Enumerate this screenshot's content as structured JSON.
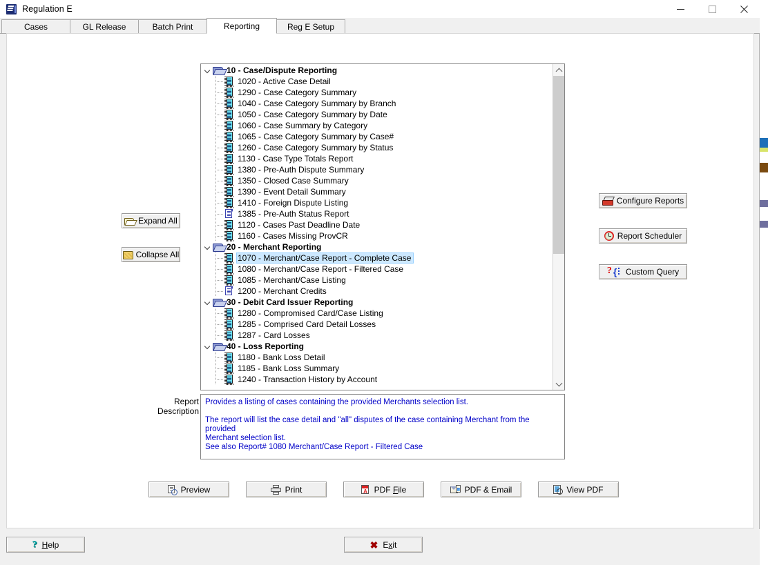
{
  "window": {
    "title": "Regulation E",
    "app_icon": "regulation-e-app-icon",
    "controls": {
      "minimize": "minimize-icon",
      "maximize": "maximize-icon",
      "close": "close-icon"
    }
  },
  "tabs": [
    {
      "label": "Cases",
      "active": false
    },
    {
      "label": "GL Release",
      "active": false
    },
    {
      "label": "Batch Print",
      "active": false
    },
    {
      "label": "Reporting",
      "active": true
    },
    {
      "label": "Reg E Setup",
      "active": false
    }
  ],
  "tree": {
    "selected": "1070 - Merchant/Case Report - Complete Case",
    "nodes": [
      {
        "type": "group",
        "label": "10 - Case/Dispute Reporting"
      },
      {
        "type": "report",
        "label": "1020 - Active Case Detail"
      },
      {
        "type": "report",
        "label": "1290 - Case Category Summary"
      },
      {
        "type": "report",
        "label": "1040 - Case Category Summary by Branch"
      },
      {
        "type": "report",
        "label": "1050 - Case Category Summary by Date"
      },
      {
        "type": "report",
        "label": "1060 - Case Summary by Category"
      },
      {
        "type": "report",
        "label": "1065 - Case Category Summary by Case#"
      },
      {
        "type": "report",
        "label": "1260 - Case Category Summary by Status"
      },
      {
        "type": "report",
        "label": "1130 - Case Type Totals Report"
      },
      {
        "type": "report",
        "label": "1380 - Pre-Auth Dispute Summary"
      },
      {
        "type": "report",
        "label": "1350 - Closed Case Summary"
      },
      {
        "type": "report",
        "label": "1390 - Event Detail Summary"
      },
      {
        "type": "report",
        "label": "1410 - Foreign Dispute Listing"
      },
      {
        "type": "page",
        "label": "1385 - Pre-Auth Status Report"
      },
      {
        "type": "report",
        "label": "1120 - Cases Past Deadline Date"
      },
      {
        "type": "report",
        "label": "1160 - Cases Missing ProvCR"
      },
      {
        "type": "group",
        "label": "20 - Merchant Reporting"
      },
      {
        "type": "report",
        "label": "1070 - Merchant/Case Report - Complete Case",
        "selected": true
      },
      {
        "type": "report",
        "label": "1080 - Merchant/Case Report - Filtered Case"
      },
      {
        "type": "report",
        "label": "1085 - Merchant/Case Listing"
      },
      {
        "type": "page",
        "label": "1200 - Merchant Credits"
      },
      {
        "type": "group",
        "label": "30 - Debit Card Issuer Reporting"
      },
      {
        "type": "report",
        "label": "1280 - Compromised Card/Case Listing"
      },
      {
        "type": "report",
        "label": "1285 - Comprised Card Detail Losses"
      },
      {
        "type": "report",
        "label": "1287 - Card Losses"
      },
      {
        "type": "group",
        "label": "40 - Loss Reporting"
      },
      {
        "type": "report",
        "label": "1180 - Bank Loss Detail"
      },
      {
        "type": "report",
        "label": "1185 - Bank Loss Summary"
      },
      {
        "type": "report",
        "label": "1240 - Transaction History by Account"
      }
    ]
  },
  "tree_buttons": {
    "expand_all": "Expand All",
    "collapse_all": "Collapse All"
  },
  "side_buttons": {
    "configure_reports": "Configure Reports",
    "report_scheduler": "Report Scheduler",
    "custom_query": "Custom Query"
  },
  "description": {
    "label_line1": "Report",
    "label_line2": "Description",
    "line1": "Provides a listing of cases containing the provided Merchants selection list.",
    "line2": "The report will list the case detail and \"all\" disputes of the case containing Merchant from the provided",
    "line3": "Merchant selection list.",
    "line4": "See also Report# 1080 Merchant/Case Report - Filtered Case",
    "text_color": "#0000c8"
  },
  "action_buttons": [
    {
      "label": "Preview",
      "icon": "preview-icon"
    },
    {
      "label": "Print",
      "icon": "printer-icon"
    },
    {
      "label": "PDF File",
      "icon": "pdf-file-icon",
      "accel": "F"
    },
    {
      "label": "PDF & Email",
      "icon": "pdf-email-icon"
    },
    {
      "label": "View PDF",
      "icon": "view-pdf-icon"
    }
  ],
  "footer": {
    "help": "Help",
    "help_accel": "H",
    "exit": "Exit",
    "exit_accel": "x"
  },
  "colors": {
    "selection": "#cce8ff",
    "description_text": "#0000c8",
    "window_bg": "#f0f0f0"
  }
}
